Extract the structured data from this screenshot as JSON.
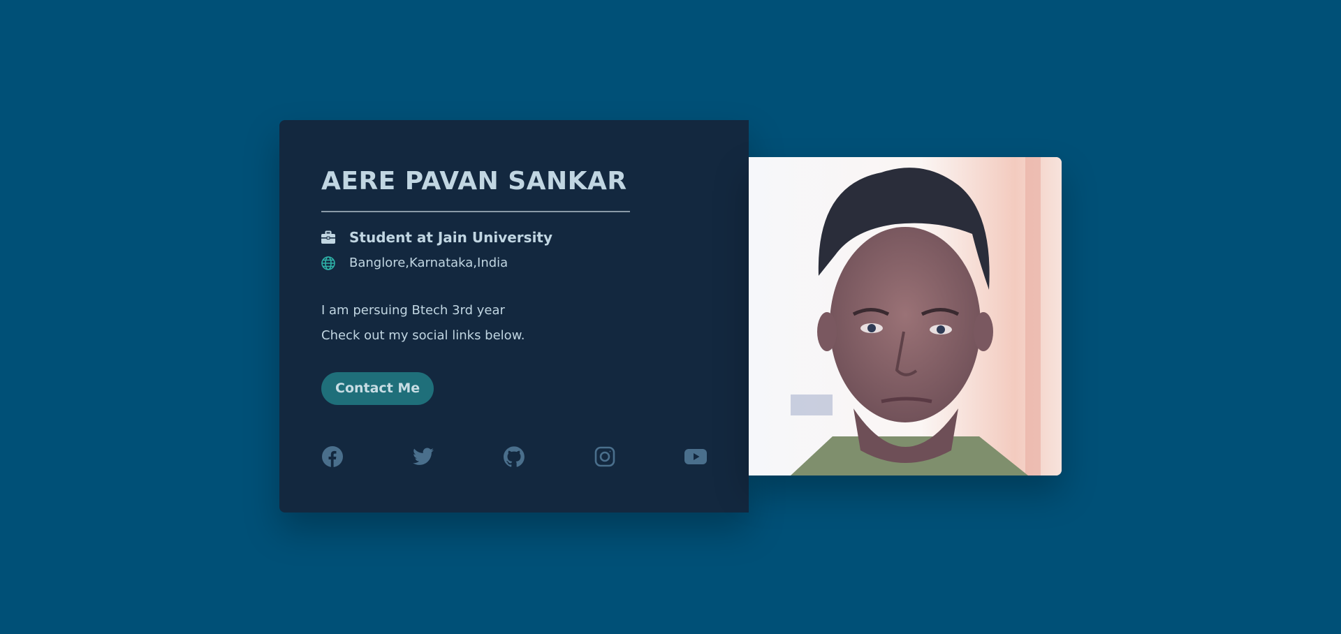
{
  "profile": {
    "name": "AERE PAVAN SANKAR",
    "job": "Student at Jain University",
    "location": "Banglore,Karnataka,India",
    "bio_line1": "I am persuing Btech 3rd year",
    "bio_line2": "Check out my social links below.",
    "contact_label": "Contact Me"
  },
  "icons": {
    "job": "briefcase-icon",
    "location": "globe-icon"
  },
  "socials": [
    "facebook-icon",
    "twitter-icon",
    "github-icon",
    "instagram-icon",
    "youtube-icon"
  ],
  "colors": {
    "page_background": "#005077",
    "card_background": "#13283f",
    "text": "#c1d6e2",
    "accent_button": "#1f6f7a",
    "globe_icon": "#2eb2a8",
    "social_icon": "#4a6f8c"
  }
}
